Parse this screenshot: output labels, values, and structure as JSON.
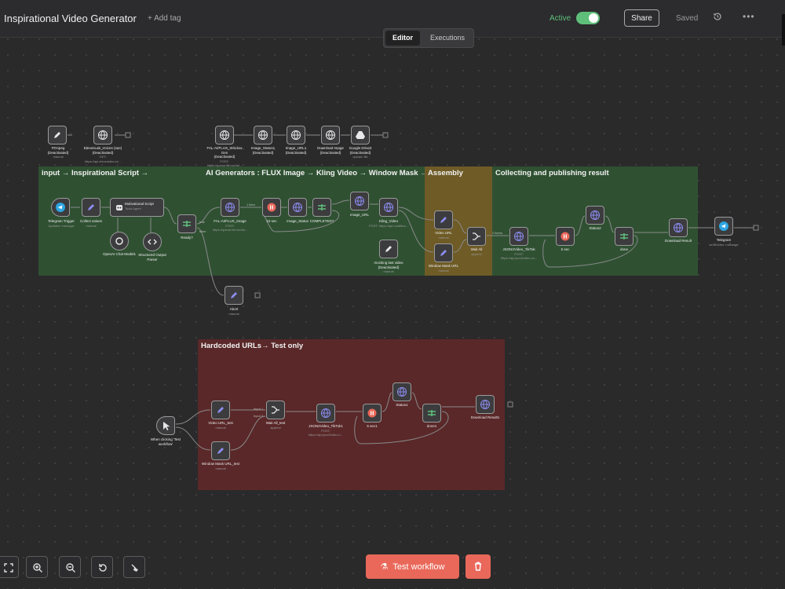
{
  "header": {
    "title": "Inspirational Video Generator",
    "add_tag": "+ Add tag",
    "active_label": "Active",
    "share_label": "Share",
    "saved_label": "Saved"
  },
  "mode": {
    "editor": "Editor",
    "executions": "Executions"
  },
  "groups": {
    "input": "input → Inspirational Script →",
    "ai": "AI Generators : FLUX Image → Kling Video → Window Mask →",
    "assembly": "Assembly",
    "collect": "Collecting and publishing result",
    "hardcoded": "Hardcoded URLs→ Test only"
  },
  "nodes": {
    "ffmpeg": {
      "label": "FFmpeg\n(Deactivated)",
      "sub": "manual"
    },
    "elevenlabs": {
      "label": "ElevenLab_Voices (see)\n(Deactivated)",
      "sub": "GET: https://api.elevenlabs.io/..."
    },
    "fal_window": {
      "label": "FAL-AI/FLUX_Window Gen\n(Deactivated)",
      "sub": "POST: https://queue.fal.run/fal..."
    },
    "image_status1": {
      "label": "Image_Status1\n(Deactivated)",
      "sub": ""
    },
    "image_url1": {
      "label": "Image_URL1\n(Deactivated)",
      "sub": ""
    },
    "download_image": {
      "label": "Download Image\n(Deactivated)",
      "sub": ""
    },
    "google_drive": {
      "label": "Google Drive3\n(Deactivated)",
      "sub": "upload: file"
    },
    "telegram_trigger": {
      "label": "Telegram Trigger",
      "sub": "Updates: message"
    },
    "collect_values": {
      "label": "Collect values",
      "sub": "manual"
    },
    "motivational": {
      "label": "Motivational Script",
      "sub": "Tools Agent"
    },
    "openai": {
      "label": "OpenAI Chat Model1"
    },
    "structured": {
      "label": "Structured Output Parser"
    },
    "ready": {
      "label": "Ready?"
    },
    "fal_flux": {
      "label": "FAL-AI/FLUX_Image",
      "sub": "POST: https://queue.fal.run/fal..."
    },
    "ten_sec": {
      "label": "10 sec"
    },
    "image_status": {
      "label": "Image_Status"
    },
    "completed": {
      "label": "COMPLETED?"
    },
    "image_url": {
      "label": "Image_URL"
    },
    "kling": {
      "label": "Kling_Video",
      "sub": "POST: https://api.rundiffus..."
    },
    "mocking": {
      "label": "mocking last video (Deactivated)",
      "sub": "manual"
    },
    "video_url": {
      "label": "Video URL",
      "sub": "manual"
    },
    "window_mask": {
      "label": "Window Mask URL",
      "sub": "manual"
    },
    "wait_all": {
      "label": "Wait All",
      "sub": "append"
    },
    "json2video": {
      "label": "JSON2Video_TikTok",
      "sub": "POST: https://api.json2video.co..."
    },
    "five_sec": {
      "label": "5 sec"
    },
    "status2": {
      "label": "Status2"
    },
    "done": {
      "label": "done"
    },
    "download_result": {
      "label": "Download Result"
    },
    "telegram": {
      "label": "Telegram",
      "sub": "sendVideo: message"
    },
    "abort": {
      "label": "Abort",
      "sub": "manual"
    },
    "when_clicking": {
      "label": "When clicking 'Test workflow'"
    },
    "video_url_test": {
      "label": "Video URL_test",
      "sub": "manual"
    },
    "window_mask_test": {
      "label": "Window Mask URL_test",
      "sub": "manual"
    },
    "wait_all_test": {
      "label": "Wait All_test",
      "sub": "append"
    },
    "json2video1": {
      "label": "JSON2Video_TikTok1",
      "sub": "POST: https://api.json2video.c..."
    },
    "five_sec1": {
      "label": "5 sec1"
    },
    "status1": {
      "label": "Status1"
    },
    "done1": {
      "label": "done1"
    },
    "download_result1": {
      "label": "Download Result1"
    }
  },
  "edges": {
    "one_item": "1 item",
    "two_items": "2 items",
    "true": "true",
    "false": "false",
    "input1": "Input 1",
    "input2": "Input 2"
  },
  "footer": {
    "test_workflow": "Test workflow"
  },
  "colors": {
    "group_green": "#2f5132",
    "group_gold": "#6e5b26",
    "group_red": "#5a2829",
    "accent": "#e9685a",
    "active": "#5fbf7a"
  }
}
